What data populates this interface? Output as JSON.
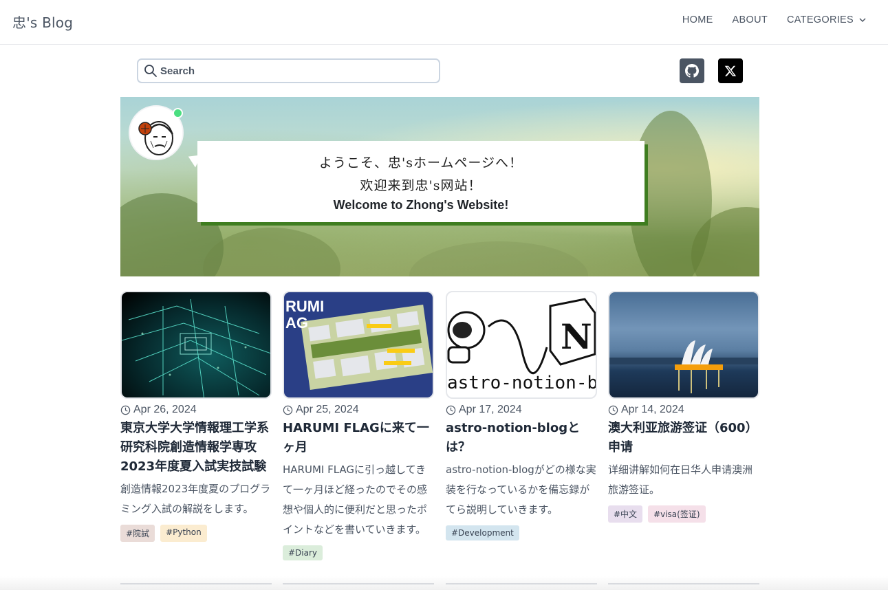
{
  "nav": {
    "brand": "忠's Blog",
    "links": {
      "home": "HOME",
      "about": "ABOUT",
      "categories": "CATEGORIES"
    }
  },
  "search": {
    "placeholder": "Search"
  },
  "social": {
    "github_icon": "github-icon",
    "x_icon": "x-icon"
  },
  "hero": {
    "line1": "ようこそ、忠'sホームページへ！",
    "line2": "欢迎来到忠's网站！",
    "line3": "Welcome to Zhong's Website!"
  },
  "posts": [
    {
      "date": "Apr 26, 2024",
      "title": "東京大学大学情報理工学系研究科院創造情報学専攻2023年度夏入試実技試験",
      "description": "創造情報2023年度夏のプログラミング入試の解説をします。",
      "tags": [
        "#院試",
        "#Python"
      ],
      "tag_colors": [
        "#eadcd8",
        "#fbecd0"
      ]
    },
    {
      "date": "Apr 25, 2024",
      "title": "HARUMI FLAGに来て一ヶ月",
      "description": "HARUMI FLAGに引っ越してきて一ヶ月ほど経ったのでその感想や個人的に便利だと思ったポイントなどを書いていきます。",
      "tags": [
        "#Diary"
      ],
      "tag_colors": [
        "#dbeddb"
      ]
    },
    {
      "date": "Apr 17, 2024",
      "title": "astro-notion-blogとは？",
      "description": "astro-notion-blogがどの様な実装を行なっているかを備忘録がてら説明していきます。",
      "tags": [
        "#Development"
      ],
      "tag_colors": [
        "#d3e5ef"
      ]
    },
    {
      "date": "Apr 14, 2024",
      "title": "澳大利亚旅游签证（600）申请",
      "description": "详细讲解如何在日华人申请澳洲旅游签证。",
      "tags": [
        "#中文",
        "#visa(签证)"
      ],
      "tag_colors": [
        "#e8deee",
        "#f5e0e9"
      ]
    }
  ],
  "card_images": {
    "post3_caption": "astro-notion-blog",
    "post2_caption": "HARUMI FLAG"
  }
}
